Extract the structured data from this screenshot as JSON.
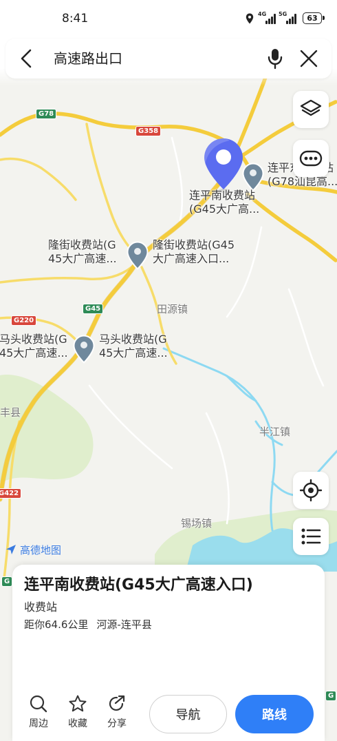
{
  "status_bar": {
    "time": "8:41",
    "network_1": "4G",
    "network_2": "5G",
    "battery": "63",
    "location_icon": "location-status-icon"
  },
  "search": {
    "query": "高速路出口",
    "back_icon": "chevron-left-icon",
    "voice_icon": "microphone-icon",
    "clear_icon": "close-icon"
  },
  "map": {
    "shields": {
      "g78": "G78",
      "g358": "G358",
      "g45": "G45",
      "g220": "G220",
      "g422": "G422",
      "g_bottom_left": "G",
      "g_bottom_right": "G"
    },
    "towns": {
      "tianyuan": "田源镇",
      "banjiang": "半江镇",
      "xichang": "锡场镇",
      "feng": "丰县"
    },
    "markers": {
      "selected": {
        "line1": "连平南收费站",
        "line2": "(G45大广高..."
      },
      "lianping_east": {
        "line1": "连平东收费站",
        "line2": "(G78汕昆高..."
      },
      "longjie_left": {
        "line1": "隆街收费站(G",
        "line2": "45大广高速..."
      },
      "longjie_right": {
        "line1": "隆街收费站(G45",
        "line2": "大广高速入口..."
      },
      "matou_left": {
        "line1": "马头收费站(G",
        "line2": "45大广高速..."
      },
      "matou_right": {
        "line1": "马头收费站(G",
        "line2": "45大广高速..."
      }
    },
    "logo": "高德地图"
  },
  "map_controls": {
    "layers_icon": "layers-icon",
    "more_icon": "more-icon",
    "locate_icon": "locate-icon",
    "list_icon": "list-icon"
  },
  "place_card": {
    "title": "连平南收费站(G45大广高速入口)",
    "category": "收费站",
    "distance": "距你64.6公里",
    "region": "河源-连平县",
    "actions": [
      {
        "label": "周边",
        "icon": "search-icon"
      },
      {
        "label": "收藏",
        "icon": "star-icon"
      },
      {
        "label": "分享",
        "icon": "share-icon"
      }
    ],
    "navigate_label": "导航",
    "route_label": "路线"
  },
  "colors": {
    "accent": "#2f7ff7",
    "map_background": "#f3f3ef",
    "highway_shield": "#2e8b57",
    "national_road_shield": "#d8473c",
    "selected_pin": "#5b6cf0",
    "other_pin": "#6f889c",
    "road": "#f4cc3c",
    "water": "#8dd9f2",
    "forest": "#e0eecd"
  }
}
